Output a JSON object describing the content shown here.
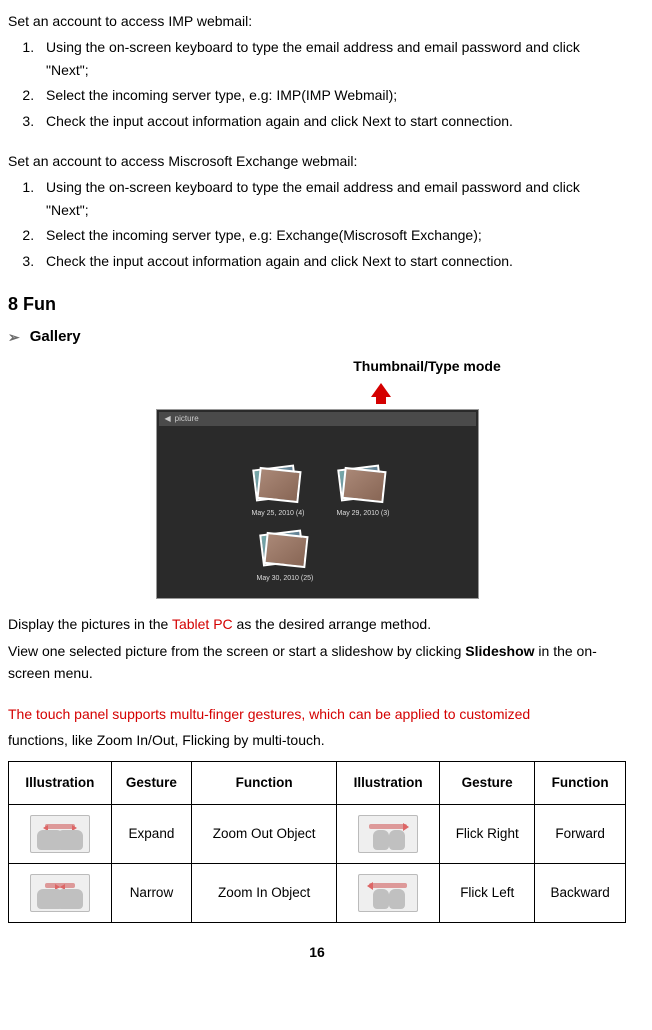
{
  "intro_imp": "Set an account to access IMP webmail:",
  "imp_steps": [
    "Using the on-screen keyboard to type the email address and email password and click \"Next\";",
    "Select the incoming server type, e.g: IMP(IMP Webmail);",
    "Check the input accout information again and click Next to start connection."
  ],
  "intro_exch": "Set an account to access Miscrosoft Exchange webmail:",
  "exch_steps": [
    "Using the on-screen keyboard to type the email address and email password and click \"Next\";",
    "Select the incoming server type, e.g: Exchange(Miscrosoft Exchange);",
    "Check the input accout information again and click Next to start connection."
  ],
  "section_heading": "8 Fun",
  "sub_heading": "Gallery",
  "callout": "Thumbnail/Type mode",
  "gallery": {
    "topbar_icon": "◀",
    "topbar_label": "picture",
    "thumbs": [
      "May 25, 2010  (4)",
      "May 29, 2010  (3)",
      "May 30, 2010  (25)"
    ]
  },
  "body1_a": "Display the pictures in the ",
  "body1_red": "Tablet PC",
  "body1_b": " as the desired arrange method.",
  "body2_a": "View one selected picture from the screen or start a slideshow by clicking ",
  "body2_bold": "Slideshow",
  "body2_b": " in the on-screen menu.",
  "body3_red": "The touch panel supports multu-finger gestures, which can be applied to customized",
  "body3_rest": "functions, like Zoom In/Out, Flicking by multi-touch.",
  "table": {
    "headers": [
      "Illustration",
      "Gesture",
      "Function",
      "Illustration",
      "Gesture",
      "Function"
    ],
    "rows": [
      {
        "gesture1": "Expand",
        "func1": "Zoom Out Object",
        "gesture2": "Flick Right",
        "func2": "Forward"
      },
      {
        "gesture1": "Narrow",
        "func1": "Zoom In Object",
        "gesture2": "Flick Left",
        "func2": "Backward"
      }
    ]
  },
  "page_number": "16"
}
